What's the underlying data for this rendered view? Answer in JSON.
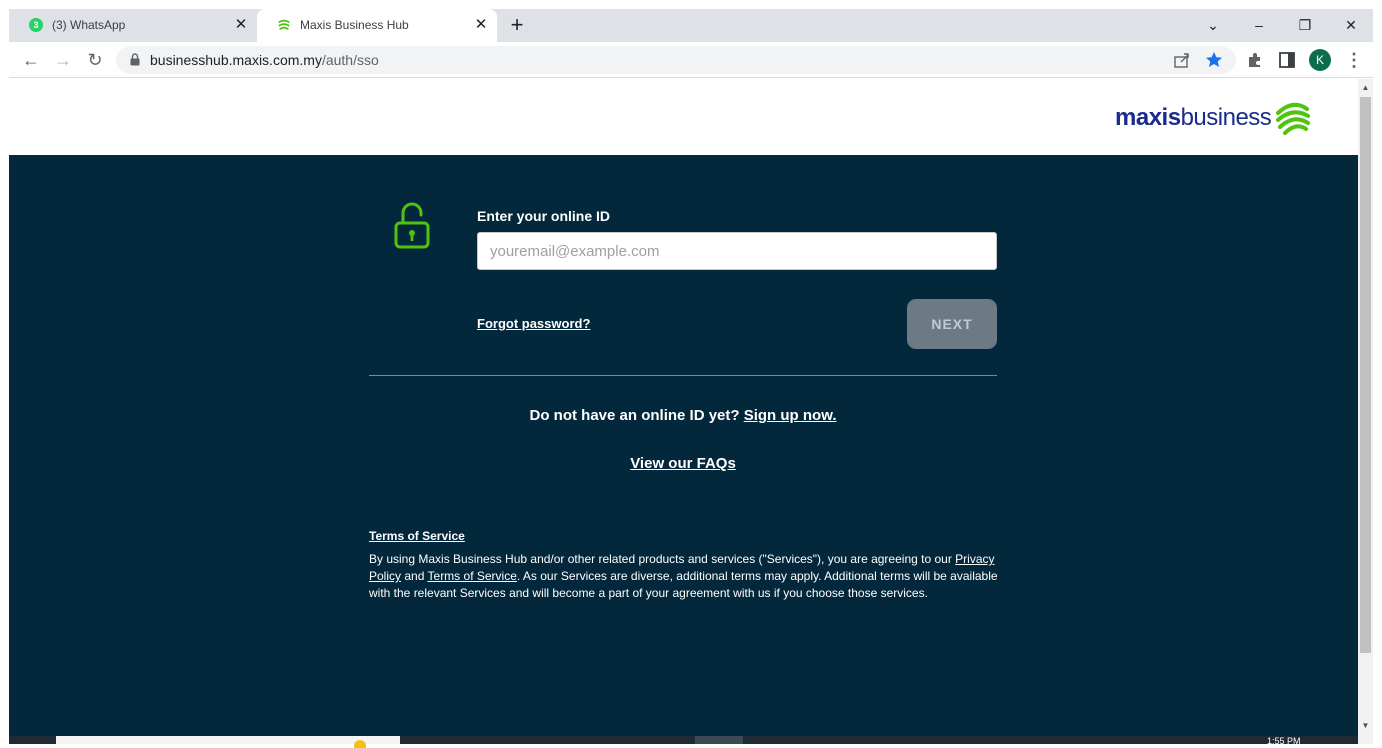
{
  "browser": {
    "tabs": [
      {
        "title": "(3) WhatsApp",
        "badge": "3",
        "icon": "whatsapp-icon",
        "active": false
      },
      {
        "title": "Maxis Business Hub",
        "icon": "maxis-favicon",
        "active": true
      }
    ],
    "new_tab_label": "+",
    "address": {
      "host": "businesshub.maxis.com.my",
      "path": "/auth/sso"
    },
    "profile_initial": "K",
    "bookmark_star_color": "#1a73e8"
  },
  "header": {
    "logo_bold": "maxis",
    "logo_light": "business",
    "logo_color": "#1a2b8c",
    "logo_accent": "#4fc30f"
  },
  "login": {
    "id_label": "Enter your online ID",
    "id_placeholder": "youremail@example.com",
    "id_value": "",
    "forgot_password": "Forgot password?",
    "next_label": "NEXT",
    "signup_prompt": "Do not have an online ID yet?",
    "signup_link": "Sign up now.",
    "faq_link": "View our FAQs",
    "panel_color": "#03283b",
    "lock_color": "#4fc30f"
  },
  "terms": {
    "heading": "Terms of Service",
    "body_part1": "By using Maxis Business Hub and/or other related products and services (\"Services\"), you are agreeing to our",
    "privacy_link": "Privacy Policy",
    "and_text": "and",
    "terms_link": "Terms of Service",
    "body_part2": ". As our Services are diverse, additional terms may apply. Additional terms will be available with the relevant Services and will become a part of your agreement with us if you choose those services."
  },
  "taskbar": {
    "clock": "1:55 PM"
  }
}
